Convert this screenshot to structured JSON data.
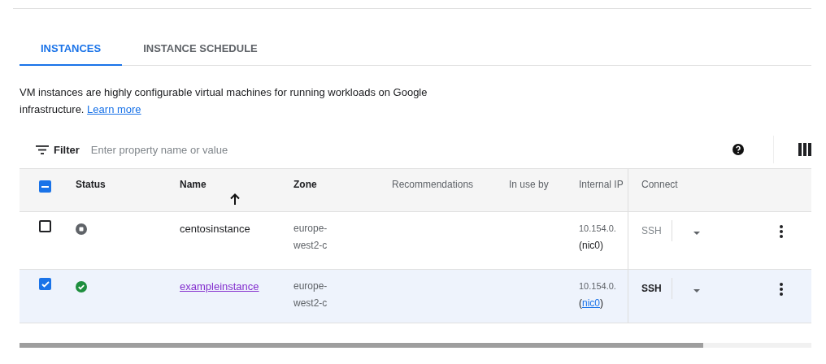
{
  "tabs": [
    {
      "label": "INSTANCES",
      "selected": true
    },
    {
      "label": "INSTANCE SCHEDULE",
      "selected": false
    }
  ],
  "description": "VM instances are highly configurable virtual machines for running workloads on Google infrastructure.",
  "learn_more": "Learn more",
  "filter": {
    "label": "Filter",
    "placeholder": "Enter property name or value"
  },
  "table": {
    "select_all": {
      "checked": true,
      "indeterminate": true
    },
    "columns": [
      "Status",
      "Name",
      "Zone",
      "Recommendations",
      "In use by",
      "Internal IP",
      "Connect"
    ],
    "rows": [
      {
        "checked": false,
        "selected": false,
        "running": false,
        "name": "centosinstance",
        "name_link": false,
        "zone": "europe-west2-c",
        "internal_ip": "10.154.0.",
        "nic_open": "(",
        "nic": "nic0",
        "nic_close": ")",
        "nic_link": false,
        "connect": "SSH",
        "connect_enabled": false
      },
      {
        "checked": true,
        "selected": true,
        "running": true,
        "name": "exampleinstance",
        "name_link": true,
        "zone": "europe-west2-c",
        "internal_ip": "10.154.0.",
        "nic_open": "(",
        "nic": "nic0",
        "nic_close": ")",
        "nic_link": true,
        "connect": "SSH",
        "connect_enabled": true
      }
    ]
  }
}
